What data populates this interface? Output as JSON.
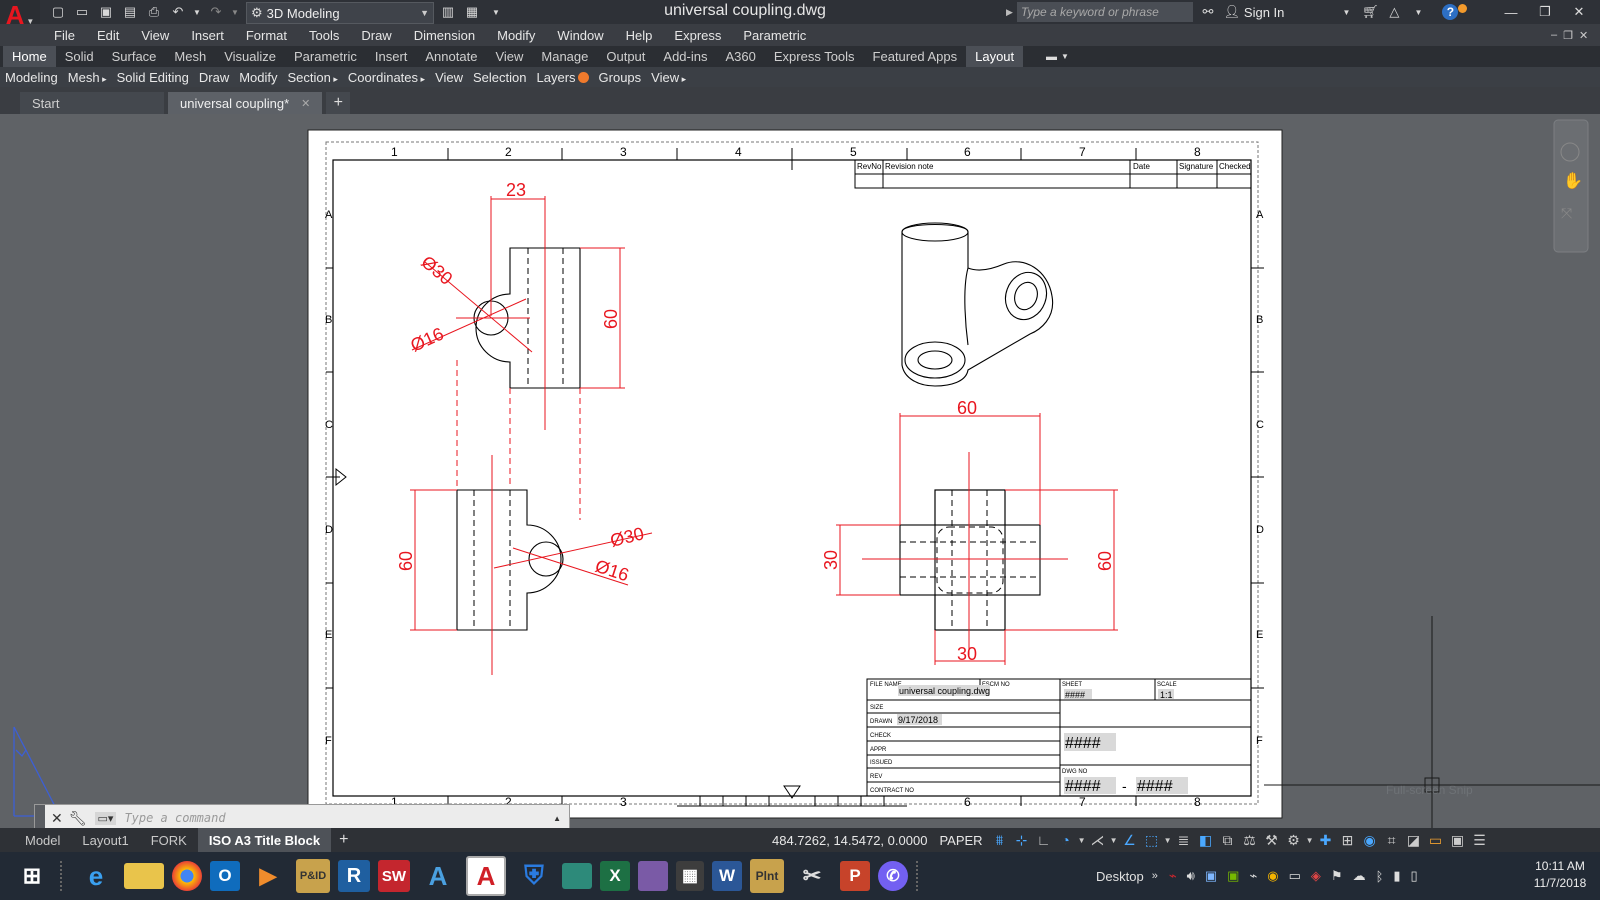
{
  "app": {
    "title": "universal coupling.dwg",
    "workspace": "3D Modeling",
    "search_placeholder": "Type a keyword or phrase",
    "sign_in": "Sign In",
    "help": "?"
  },
  "menus": [
    "File",
    "Edit",
    "View",
    "Insert",
    "Format",
    "Tools",
    "Draw",
    "Dimension",
    "Modify",
    "Window",
    "Help",
    "Express",
    "Parametric"
  ],
  "ribbon_tabs": [
    "Home",
    "Solid",
    "Surface",
    "Mesh",
    "Visualize",
    "Parametric",
    "Insert",
    "Annotate",
    "View",
    "Manage",
    "Output",
    "Add-ins",
    "A360",
    "Express Tools",
    "Featured Apps",
    "Layout"
  ],
  "ribbon_panels": [
    "Modeling",
    "Mesh",
    "Solid Editing",
    "Draw",
    "Modify",
    "Section",
    "Coordinates",
    "View",
    "Selection",
    "Layers",
    "Groups",
    "View"
  ],
  "doc_tabs": [
    {
      "label": "Start",
      "active": false
    },
    {
      "label": "universal coupling*",
      "active": true
    }
  ],
  "drawing": {
    "col_labels": [
      "1",
      "2",
      "3",
      "4",
      "5",
      "6",
      "7",
      "8"
    ],
    "row_labels": [
      "A",
      "B",
      "C",
      "D",
      "E",
      "F"
    ],
    "revision_table": {
      "headers": [
        "RevNo",
        "Revision note",
        "Date",
        "Signature",
        "Checked"
      ]
    },
    "dims": {
      "top_width": "23",
      "top_dia_large": "Ø30",
      "top_dia_small": "Ø16",
      "top_height": "60",
      "front_height": "60",
      "front_dia_large": "Ø30",
      "front_dia_small": "Ø16",
      "side_width": "60",
      "side_height_left": "30",
      "side_height_right": "60",
      "side_bottom": "30"
    },
    "title_block": {
      "file_name_label": "FILE NAME",
      "file_name": "universal coupling.dwg",
      "fscm_label": "FSCM NO",
      "sheet_label": "SHEET",
      "sheet": "####",
      "scale_label": "SCALE",
      "scale": "1:1",
      "size_label": "SIZE",
      "drawn_label": "DRAWN",
      "drawn": "9/17/2018",
      "check_label": "CHECK",
      "appr_label": "APPR",
      "issued_label": "ISSUED",
      "rev_label": "REV",
      "contract_label": "CONTRACT NO",
      "big_field": "####",
      "dwg_no_label": "DWG NO",
      "dwg_no_a": "####",
      "dwg_no_sep": "-",
      "dwg_no_b": "####"
    }
  },
  "command_line": {
    "placeholder": "Type a command"
  },
  "faded_text": "Full-screen Snip",
  "layout_tabs": [
    {
      "label": "Model",
      "active": false
    },
    {
      "label": "Layout1",
      "active": false
    },
    {
      "label": "FORK",
      "active": false
    },
    {
      "label": "ISO A3 Title Block",
      "active": true
    }
  ],
  "status": {
    "coords": "484.7262, 14.5472, 0.0000",
    "space": "PAPER"
  },
  "taskbar": {
    "desktop_label": "Desktop",
    "time": "10:11 AM",
    "date": "11/7/2018"
  },
  "colors": {
    "dimension": "#e8161f",
    "title_bg": "#2e3137",
    "canvas": "#5f6266",
    "paper": "#ffffff",
    "accent": "#4aa8ff"
  }
}
